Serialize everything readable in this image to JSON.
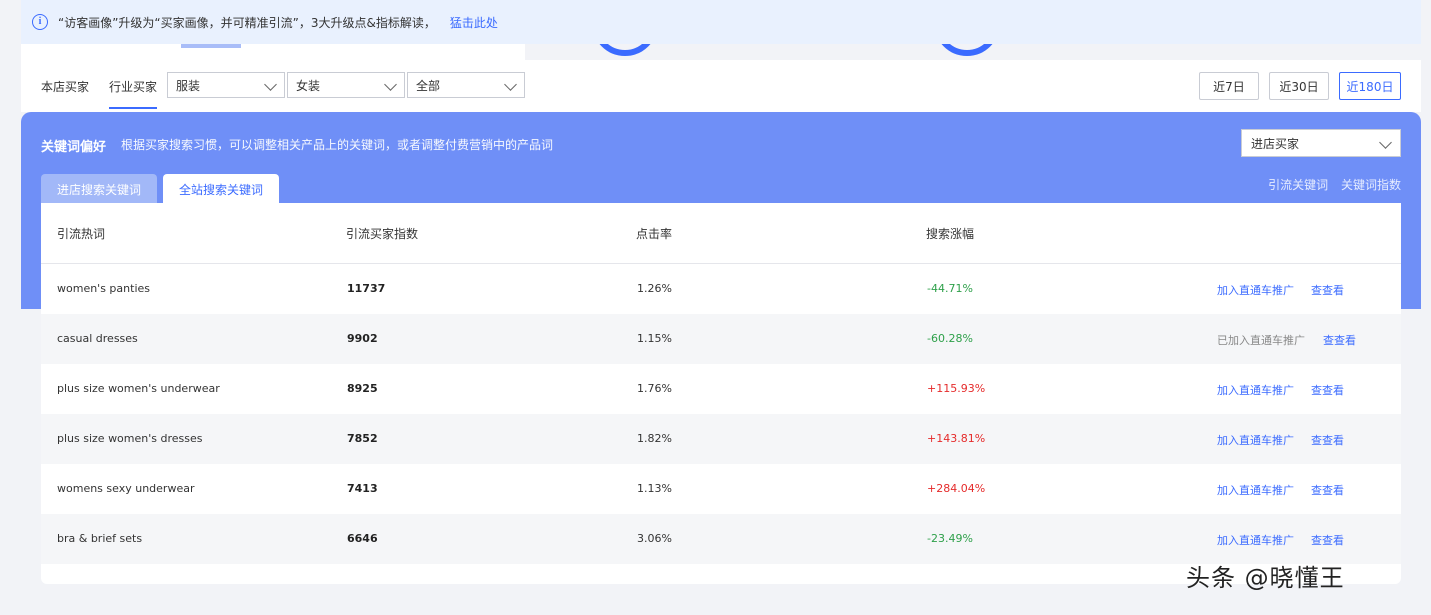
{
  "notice": {
    "text": "“访客画像”升级为“买家画像，并可精准引流”，3大升级点&指标解读，",
    "link": "猛击此处"
  },
  "filter": {
    "tabs": [
      "本店买家",
      "行业买家"
    ],
    "active_tab": "行业买家",
    "selects": [
      "服装",
      "女装",
      "全部"
    ],
    "ranges": [
      "近7日",
      "近30日",
      "近180日"
    ],
    "active_range": "近180日"
  },
  "panel": {
    "title": "关键词偏好",
    "desc": "根据买家搜索习惯，可以调整相关产品上的关键词，或者调整付费营销中的产品词",
    "select_value": "进店买家",
    "tabs": [
      "进店搜索关键词",
      "全站搜索关键词"
    ],
    "active_tab": "全站搜索关键词",
    "links": [
      "引流关键词",
      "关键词指数"
    ]
  },
  "table": {
    "headers": [
      "引流热词",
      "引流买家指数",
      "点击率",
      "搜索涨幅"
    ],
    "rows": [
      {
        "keyword": "women's panties",
        "index": "11737",
        "ctr": "1.26%",
        "growth": "-44.71%",
        "action": "加入直通车推广",
        "view": "查查看",
        "added": false
      },
      {
        "keyword": "casual dresses",
        "index": "9902",
        "ctr": "1.15%",
        "growth": "-60.28%",
        "action": "已加入直通车推广",
        "view": "查查看",
        "added": true
      },
      {
        "keyword": "plus size women's underwear",
        "index": "8925",
        "ctr": "1.76%",
        "growth": "+115.93%",
        "action": "加入直通车推广",
        "view": "查查看",
        "added": false
      },
      {
        "keyword": "plus size women's dresses",
        "index": "7852",
        "ctr": "1.82%",
        "growth": "+143.81%",
        "action": "加入直通车推广",
        "view": "查查看",
        "added": false
      },
      {
        "keyword": "womens sexy underwear",
        "index": "7413",
        "ctr": "1.13%",
        "growth": "+284.04%",
        "action": "加入直通车推广",
        "view": "查查看",
        "added": false
      },
      {
        "keyword": "bra & brief sets",
        "index": "6646",
        "ctr": "3.06%",
        "growth": "-23.49%",
        "action": "加入直通车推广",
        "view": "查查看",
        "added": false
      }
    ]
  },
  "watermark": "头条 @晓懂王",
  "colors": {
    "accent": "#3b6bff",
    "panel": "#6f8ff7",
    "up": "#e52b2b",
    "down": "#2ea04a"
  }
}
